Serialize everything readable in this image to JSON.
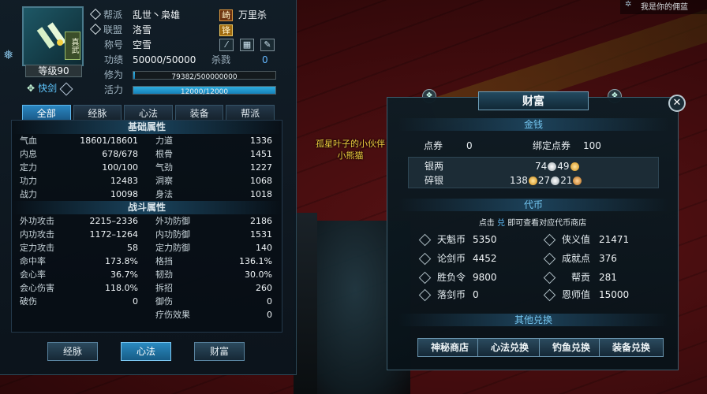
{
  "character": {
    "sect_badge": "真武",
    "level": "等级90",
    "skill": "快剑",
    "rows": {
      "sect": {
        "label": "帮派",
        "value": "乱世丶枭雄",
        "tag": "崎",
        "extra": "万里杀"
      },
      "alliance": {
        "label": "联盟",
        "value": "洛雪",
        "tag": "锋"
      },
      "title": {
        "label": "称号",
        "value": "空雪"
      },
      "merit": {
        "label": "功绩",
        "value": "50000/50000",
        "extra_label": "杀戮",
        "extra_value": "0"
      },
      "cultivation": {
        "label": "修为",
        "bar_text": "79382/500000000",
        "fraction": 0.0002
      },
      "vitality": {
        "label": "活力",
        "bar_text": "12000/12000",
        "fraction": 1.0
      }
    }
  },
  "tabs": [
    {
      "label": "全部",
      "active": true
    },
    {
      "label": "经脉",
      "active": false
    },
    {
      "label": "心法",
      "active": false
    },
    {
      "label": "装备",
      "active": false
    },
    {
      "label": "帮派",
      "active": false
    }
  ],
  "basic_attributes": {
    "title": "基础属性",
    "items": [
      {
        "k": "气血",
        "v": "18601/18601"
      },
      {
        "k": "力道",
        "v": "1336"
      },
      {
        "k": "内息",
        "v": "678/678"
      },
      {
        "k": "根骨",
        "v": "1451"
      },
      {
        "k": "定力",
        "v": "100/100"
      },
      {
        "k": "气劲",
        "v": "1227"
      },
      {
        "k": "功力",
        "v": "12483"
      },
      {
        "k": "洞察",
        "v": "1068"
      },
      {
        "k": "战力",
        "v": "10098"
      },
      {
        "k": "身法",
        "v": "1018"
      }
    ]
  },
  "combat_attributes": {
    "title": "战斗属性",
    "items": [
      {
        "k": "外功攻击",
        "v": "2215–2336"
      },
      {
        "k": "外功防御",
        "v": "2186"
      },
      {
        "k": "内功攻击",
        "v": "1172–1264"
      },
      {
        "k": "内功防御",
        "v": "1531"
      },
      {
        "k": "定力攻击",
        "v": "58"
      },
      {
        "k": "定力防御",
        "v": "140"
      },
      {
        "k": "命中率",
        "v": "173.8%"
      },
      {
        "k": "格挡",
        "v": "136.1%"
      },
      {
        "k": "会心率",
        "v": "36.7%"
      },
      {
        "k": "韧劲",
        "v": "30.0%"
      },
      {
        "k": "会心伤害",
        "v": "118.0%"
      },
      {
        "k": "拆招",
        "v": "260"
      },
      {
        "k": "破伤",
        "v": "0"
      },
      {
        "k": "御伤",
        "v": "0"
      },
      {
        "k": "",
        "v": ""
      },
      {
        "k": "疗伤效果",
        "v": "0"
      }
    ]
  },
  "bottom_buttons": [
    {
      "label": "经脉",
      "active": false
    },
    {
      "label": "心法",
      "active": true
    },
    {
      "label": "财富",
      "active": false
    }
  ],
  "npc_label": {
    "line1": "孤星叶子的小伙伴",
    "line2": "小熊猫"
  },
  "top_right_hint": "我是你的佣蓝",
  "wealth": {
    "title": "财富",
    "money_section": "金钱",
    "coupon_label": "点券",
    "coupon_value": "0",
    "bound_coupon_label": "绑定点券",
    "bound_coupon_value": "100",
    "silver_label": "银两",
    "silver_a": "74",
    "silver_b": "49",
    "broken_silver_label": "碎银",
    "broken_a": "138",
    "broken_b": "27",
    "broken_c": "21",
    "token_section": "代币",
    "hint_prefix": "点击",
    "hint_icon": "兑",
    "hint_suffix": "即可查看对应代币商店",
    "currencies": [
      {
        "label": "天魁币",
        "value": "5350"
      },
      {
        "label": "侠义值",
        "value": "21471"
      },
      {
        "label": "论剑币",
        "value": "4452"
      },
      {
        "label": "成就点",
        "value": "376"
      },
      {
        "label": "胜负令",
        "value": "9800"
      },
      {
        "label": "帮贡",
        "value": "281"
      },
      {
        "label": "落剑币",
        "value": "0"
      },
      {
        "label": "恩师值",
        "value": "15000"
      }
    ],
    "other_section": "其他兑换",
    "exchange_buttons": [
      {
        "label": "神秘商店"
      },
      {
        "label": "心法兑换"
      },
      {
        "label": "钓鱼兑换"
      },
      {
        "label": "装备兑换"
      }
    ]
  },
  "colors": {
    "accent": "#2a86c0",
    "value_blue": "#64b8ff",
    "npc_yellow": "#f4d040"
  }
}
